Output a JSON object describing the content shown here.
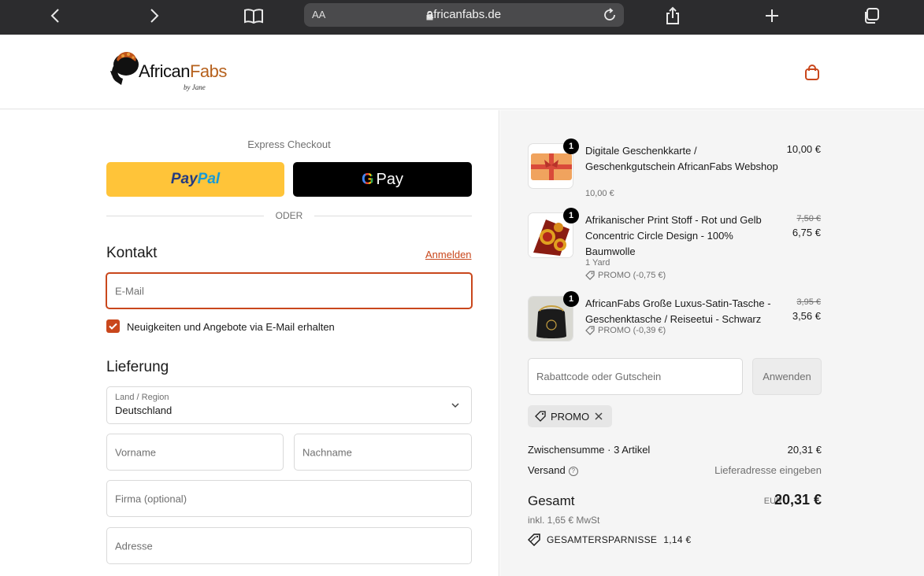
{
  "browser": {
    "aa_label": "AA",
    "url": "africanfabs.de"
  },
  "header": {
    "logo_main": "African",
    "logo_accent": "Fabs",
    "logo_sub": "by Jane"
  },
  "express": {
    "title": "Express Checkout",
    "paypal_pay": "Pay",
    "paypal_pal": "Pal",
    "gpay_g": "G",
    "gpay_label": "Pay",
    "divider": "ODER"
  },
  "contact": {
    "title": "Kontakt",
    "login_link": "Anmelden",
    "email_placeholder": "E-Mail",
    "newsletter_label": "Neuigkeiten und Angebote via E-Mail erhalten",
    "newsletter_checked": true
  },
  "delivery": {
    "title": "Lieferung",
    "country_label": "Land / Region",
    "country_value": "Deutschland",
    "first_name_placeholder": "Vorname",
    "last_name_placeholder": "Nachname",
    "company_placeholder": "Firma (optional)",
    "address_placeholder": "Adresse"
  },
  "cart": {
    "items": [
      {
        "qty": "1",
        "title": "Digitale Geschenkkarte / Geschenkgutschein AfricanFabs Webshop",
        "sub": "10,00 €",
        "price": "10,00 €"
      },
      {
        "qty": "1",
        "title": "Afrikanischer Print Stoff - Rot und Gelb Concentric Circle Design - 100% Baumwolle",
        "variant": "1 Yard",
        "discount": "PROMO (-0,75 €)",
        "price_old": "7,50 €",
        "price": "6,75 €"
      },
      {
        "qty": "1",
        "title": "AfricanFabs Große Luxus-Satin-Tasche - Geschenktasche / Reiseetui - Schwarz",
        "discount": "PROMO (-0,39 €)",
        "price_old": "3,95 €",
        "price": "3,56 €"
      }
    ],
    "discount_placeholder": "Rabattcode oder Gutschein",
    "apply_label": "Anwenden",
    "promo_code": "PROMO"
  },
  "summary": {
    "subtotal_label": "Zwischensumme · 3 Artikel",
    "subtotal_value": "20,31 €",
    "shipping_label": "Versand",
    "shipping_help": "?",
    "shipping_value": "Lieferadresse eingeben",
    "total_label": "Gesamt",
    "currency": "EUR",
    "total_value": "20,31 €",
    "tax_note": "inkl. 1,65 € MwSt",
    "savings_label": "GESAMTERSPARNISSE",
    "savings_value": "1,14 €"
  },
  "colors": {
    "accent": "#c9471c",
    "paypal_yellow": "#ffc439",
    "brand_orange": "#b6611d"
  }
}
